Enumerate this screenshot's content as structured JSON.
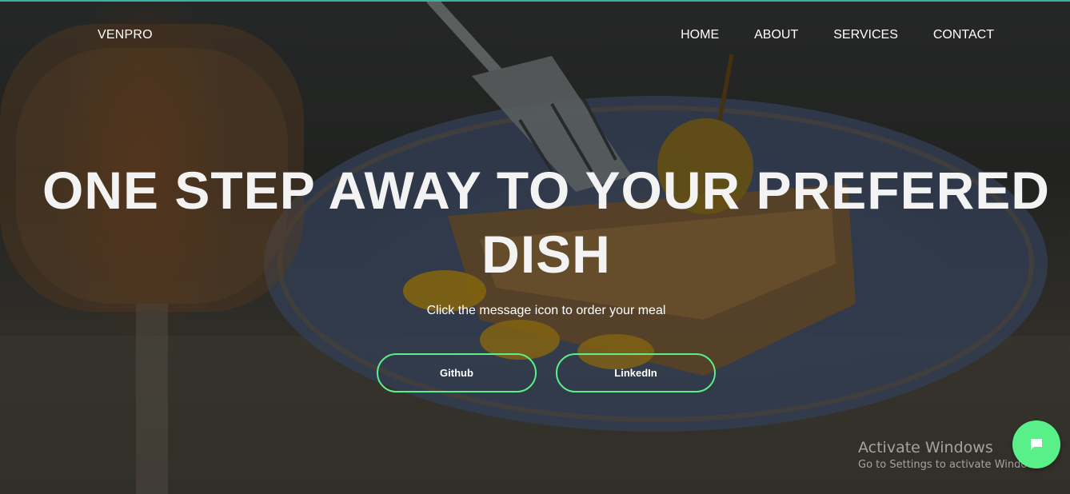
{
  "header": {
    "brand": "VENPRO",
    "nav": [
      {
        "label": "HOME"
      },
      {
        "label": "ABOUT"
      },
      {
        "label": "SERVICES"
      },
      {
        "label": "CONTACT"
      }
    ]
  },
  "hero": {
    "headline_line1": "ONE STEP AWAY TO YOUR PREFERED",
    "headline_line2": "DISH",
    "subtitle": "Click the message icon to order your meal",
    "buttons": {
      "github": "Github",
      "linkedin": "LinkedIn"
    }
  },
  "chat": {
    "icon": "message-icon"
  },
  "watermark": {
    "title": "Activate Windows",
    "subtitle": "Go to Settings to activate Windows."
  },
  "colors": {
    "accent": "#59f08a",
    "top_border": "#3bb3a3",
    "text": "#ffffff"
  }
}
